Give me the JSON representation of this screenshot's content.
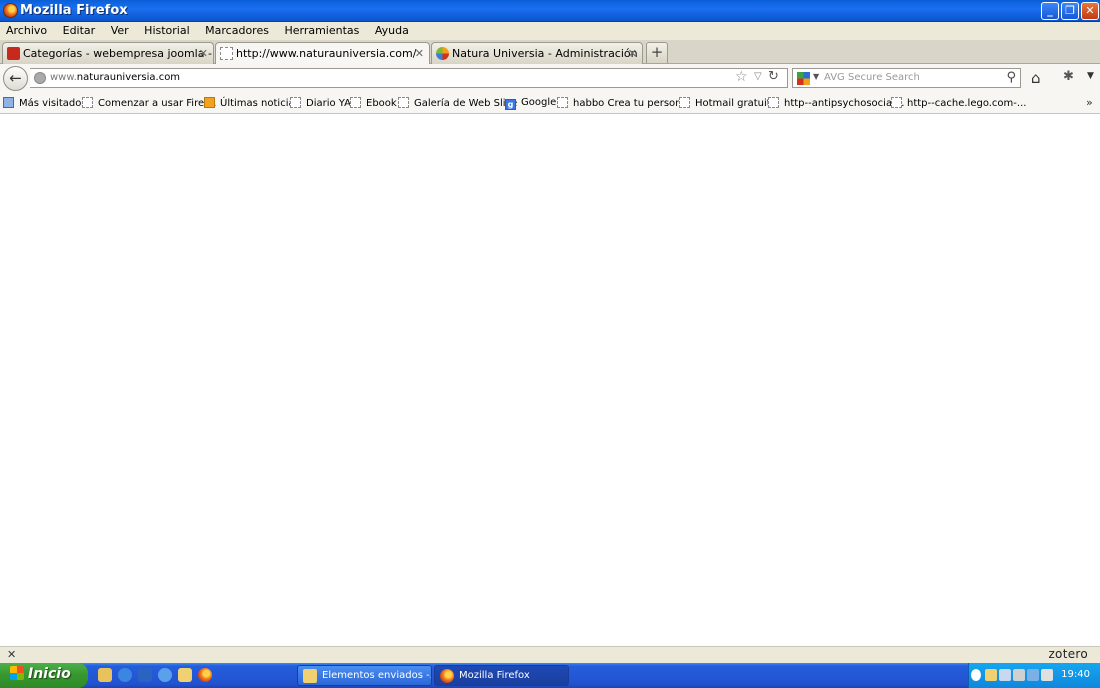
{
  "window": {
    "title": "Mozilla Firefox",
    "buttons": {
      "minimize": "_",
      "maximize": "❐",
      "close": "✕"
    }
  },
  "menubar": [
    "Archivo",
    "Editar",
    "Ver",
    "Historial",
    "Marcadores",
    "Herramientas",
    "Ayuda"
  ],
  "tabs": [
    {
      "label": "Categorías - webempresa joomla - Hostin...",
      "icon": "webempresa-icon",
      "active": false
    },
    {
      "label": "http://www.naturauniversia.com/",
      "icon": "blank-page-icon",
      "active": true
    },
    {
      "label": "Natura Universia - Administración",
      "icon": "joomla-icon",
      "active": false
    }
  ],
  "newtab_label": "+",
  "navbar": {
    "back_label": "←",
    "url_prefix": "www.",
    "url_rest": "naturauniversia.com",
    "search_placeholder": "AVG Secure Search"
  },
  "bookmarks": [
    {
      "label": "Más visitados",
      "icon": "folder-icon"
    },
    {
      "label": "Comenzar a usar Firef...",
      "icon": "blank-page-icon"
    },
    {
      "label": "Últimas noticias",
      "icon": "rss-icon"
    },
    {
      "label": "Diario YA",
      "icon": "blank-page-icon"
    },
    {
      "label": "Ebook",
      "icon": "blank-page-icon"
    },
    {
      "label": "Galería de Web Slice",
      "icon": "blank-page-icon"
    },
    {
      "label": "Google",
      "icon": "google-icon"
    },
    {
      "label": "habbo Crea tu person...",
      "icon": "blank-page-icon"
    },
    {
      "label": "Hotmail gratuito",
      "icon": "blank-page-icon"
    },
    {
      "label": "http--antipsychosocial...",
      "icon": "blank-page-icon"
    },
    {
      "label": "http--cache.lego.com-...",
      "icon": "blank-page-icon"
    }
  ],
  "bookmarks_more": "»",
  "addonbar": {
    "close": "✕",
    "zotero": "zotero"
  },
  "taskbar": {
    "start_label": "Inicio",
    "items": [
      {
        "label": "Elementos enviados -...",
        "icon": "mail-icon"
      },
      {
        "label": "Mozilla Firefox",
        "icon": "firefox-icon"
      }
    ],
    "clock": "19:40"
  }
}
